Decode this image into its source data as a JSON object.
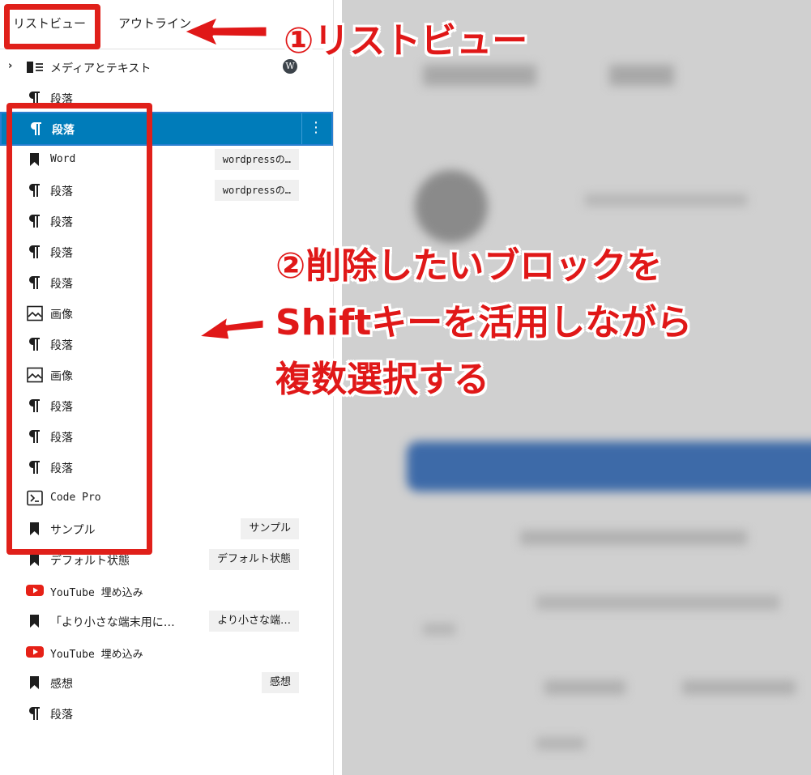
{
  "tabs": {
    "list_view": "リストビュー",
    "outline": "アウトライン"
  },
  "blocks": [
    {
      "label": "メディアとテキスト",
      "icon": "media-text-icon",
      "badge": "",
      "has_chevron": true,
      "wp_badge": true
    },
    {
      "label": "段落",
      "icon": "paragraph-icon",
      "badge": ""
    },
    {
      "label": "段落",
      "icon": "paragraph-icon",
      "badge": "",
      "selected": true
    },
    {
      "label": "Word",
      "icon": "bookmark-icon",
      "badge": "wordpressの…"
    },
    {
      "label": "段落",
      "icon": "paragraph-icon",
      "badge": "wordpressの…"
    },
    {
      "label": "段落",
      "icon": "paragraph-icon",
      "badge": ""
    },
    {
      "label": "段落",
      "icon": "paragraph-icon",
      "badge": ""
    },
    {
      "label": "段落",
      "icon": "paragraph-icon",
      "badge": ""
    },
    {
      "label": "画像",
      "icon": "image-icon",
      "badge": ""
    },
    {
      "label": "段落",
      "icon": "paragraph-icon",
      "badge": ""
    },
    {
      "label": "画像",
      "icon": "image-icon",
      "badge": ""
    },
    {
      "label": "段落",
      "icon": "paragraph-icon",
      "badge": ""
    },
    {
      "label": "段落",
      "icon": "paragraph-icon",
      "badge": ""
    },
    {
      "label": "段落",
      "icon": "paragraph-icon",
      "badge": ""
    },
    {
      "label": "Code Pro",
      "icon": "code-icon",
      "badge": ""
    },
    {
      "label": "サンプル",
      "icon": "bookmark-icon",
      "badge": "サンプル"
    },
    {
      "label": "デフォルト状態",
      "icon": "bookmark-icon",
      "badge": "デフォルト状態"
    },
    {
      "label": "YouTube 埋め込み",
      "icon": "youtube-icon",
      "badge": ""
    },
    {
      "label": "「より小さな端末用に…",
      "icon": "bookmark-icon",
      "badge": "より小さな端…"
    },
    {
      "label": "YouTube 埋め込み",
      "icon": "youtube-icon",
      "badge": ""
    },
    {
      "label": "感想",
      "icon": "bookmark-icon",
      "badge": "感想"
    },
    {
      "label": "段落",
      "icon": "paragraph-icon",
      "badge": ""
    }
  ],
  "annotations": {
    "step1": "①リストビュー",
    "step2_line1": "②削除したいブロックを",
    "step2_line2": "Shiftキーを活用しながら",
    "step2_line3": "複数選択する"
  },
  "colors": {
    "selected_bg": "#007cba",
    "annotation_red": "#e01818",
    "youtube_red": "#e62117"
  }
}
